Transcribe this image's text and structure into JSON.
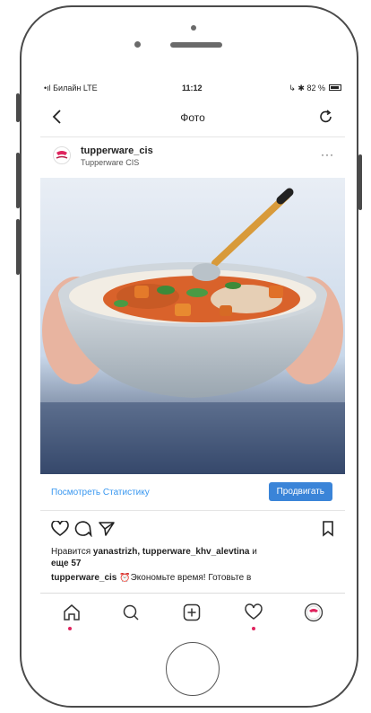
{
  "status_bar": {
    "carrier": "•ıl Билайн LTE",
    "time": "11:12",
    "battery": "↳ ✱ 82 %"
  },
  "nav": {
    "title": "Фото",
    "icons": [
      "chevron-left-icon",
      "refresh-icon"
    ]
  },
  "post": {
    "username": "tupperware_cis",
    "subtitle": "Tupperware CIS",
    "more": "···"
  },
  "promo": {
    "stats_link": "Посмотреть Статистику",
    "promote_button": "Продвигать",
    "accent_color": "#3a84d8"
  },
  "likes": {
    "prefix": "Нравится ",
    "names": "yanastrizh, tupperware_khv_alevtina",
    "and": " и",
    "more": "еще 57"
  },
  "caption": {
    "user": "tupperware_cis",
    "text": " ⏰Экономьте время! Готовьте в"
  },
  "tab_bar": {
    "tabs": [
      "home-icon",
      "search-icon",
      "add-icon",
      "heart-icon",
      "profile-icon"
    ],
    "notification_color": "#e0245e"
  }
}
